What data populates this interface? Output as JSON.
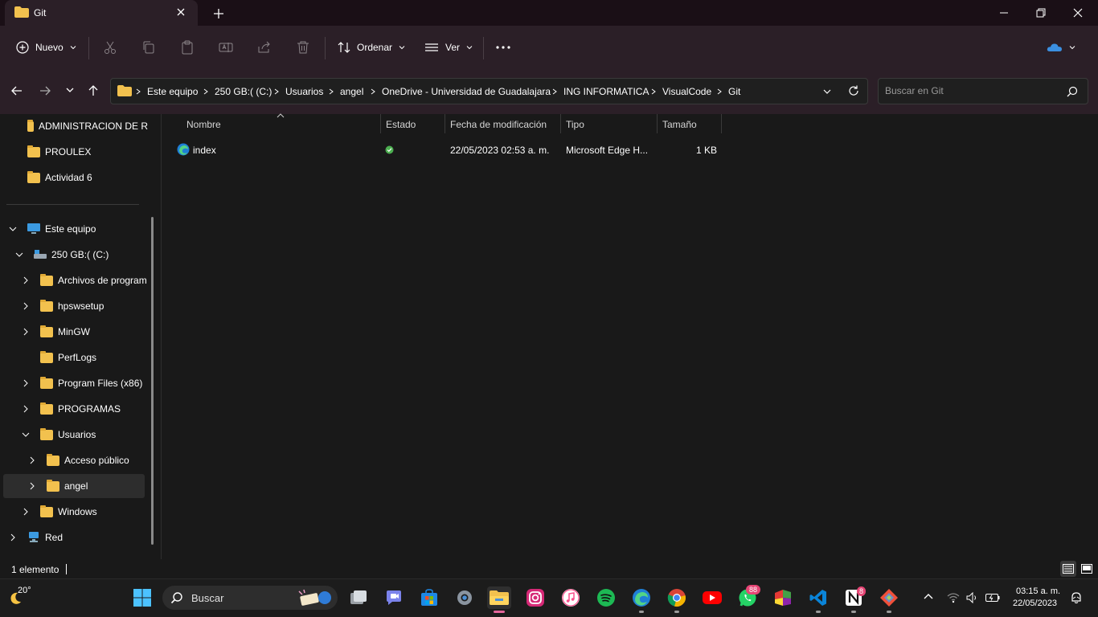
{
  "window": {
    "title": "Git"
  },
  "toolbar": {
    "new_label": "Nuevo",
    "sort_label": "Ordenar",
    "view_label": "Ver"
  },
  "breadcrumbs": [
    "Este equipo",
    "250 GB:( (C:)",
    "Usuarios",
    "angel",
    "OneDrive - Universidad de Guadalajara",
    "ING INFORMATICA",
    "VisualCode",
    "Git"
  ],
  "search": {
    "placeholder": "Buscar en Git"
  },
  "nav": {
    "quick": [
      "ADMINISTRACION DE R",
      "PROULEX",
      "Actividad 6"
    ],
    "tree": [
      {
        "label": "Este equipo"
      },
      {
        "label": "250 GB:( (C:)"
      },
      {
        "label": "Archivos de program"
      },
      {
        "label": "hpswsetup"
      },
      {
        "label": "MinGW"
      },
      {
        "label": "PerfLogs"
      },
      {
        "label": "Program Files (x86)"
      },
      {
        "label": "PROGRAMAS"
      },
      {
        "label": "Usuarios"
      },
      {
        "label": "Acceso público"
      },
      {
        "label": "angel"
      },
      {
        "label": "Windows"
      },
      {
        "label": "Red"
      }
    ]
  },
  "columns": [
    "Nombre",
    "Estado",
    "Fecha de modificación",
    "Tipo",
    "Tamaño"
  ],
  "files": [
    {
      "name": "index",
      "modified": "22/05/2023 02:53 a. m.",
      "type": "Microsoft Edge H...",
      "size": "1 KB"
    }
  ],
  "status": {
    "count": "1 elemento"
  },
  "taskbar": {
    "weather_temp": "20°",
    "search_label": "Buscar",
    "whatsapp_badge": "88",
    "notion_badge": "8",
    "time": "03:15 a. m.",
    "date": "22/05/2023"
  },
  "colors": {
    "accent": "#2b1f27",
    "folder": "#f2c14e",
    "status_ok": "#4caf50"
  }
}
